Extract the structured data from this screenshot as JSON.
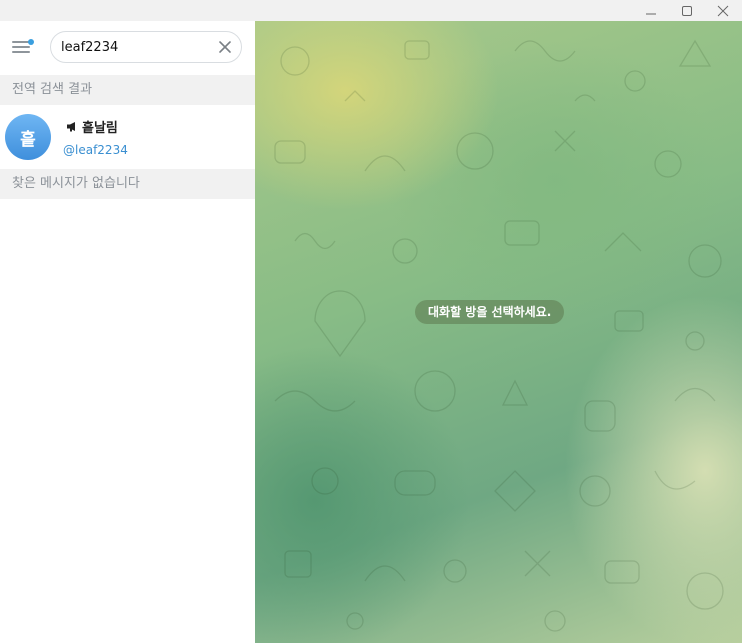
{
  "search": {
    "value": "leaf2234"
  },
  "sections": {
    "global_results": "전역 검색 결과",
    "no_messages": "찾은 메시지가 없습니다"
  },
  "result": {
    "avatar_letter": "흩",
    "title": "흩날림",
    "username": "@leaf2234",
    "type_icon": "megaphone-icon"
  },
  "chat": {
    "placeholder": "대화할 방을 선택하세요."
  },
  "colors": {
    "accent": "#3a8fd1",
    "avatar": "#4a9be6",
    "unread_dot": "#3a9fdf"
  }
}
